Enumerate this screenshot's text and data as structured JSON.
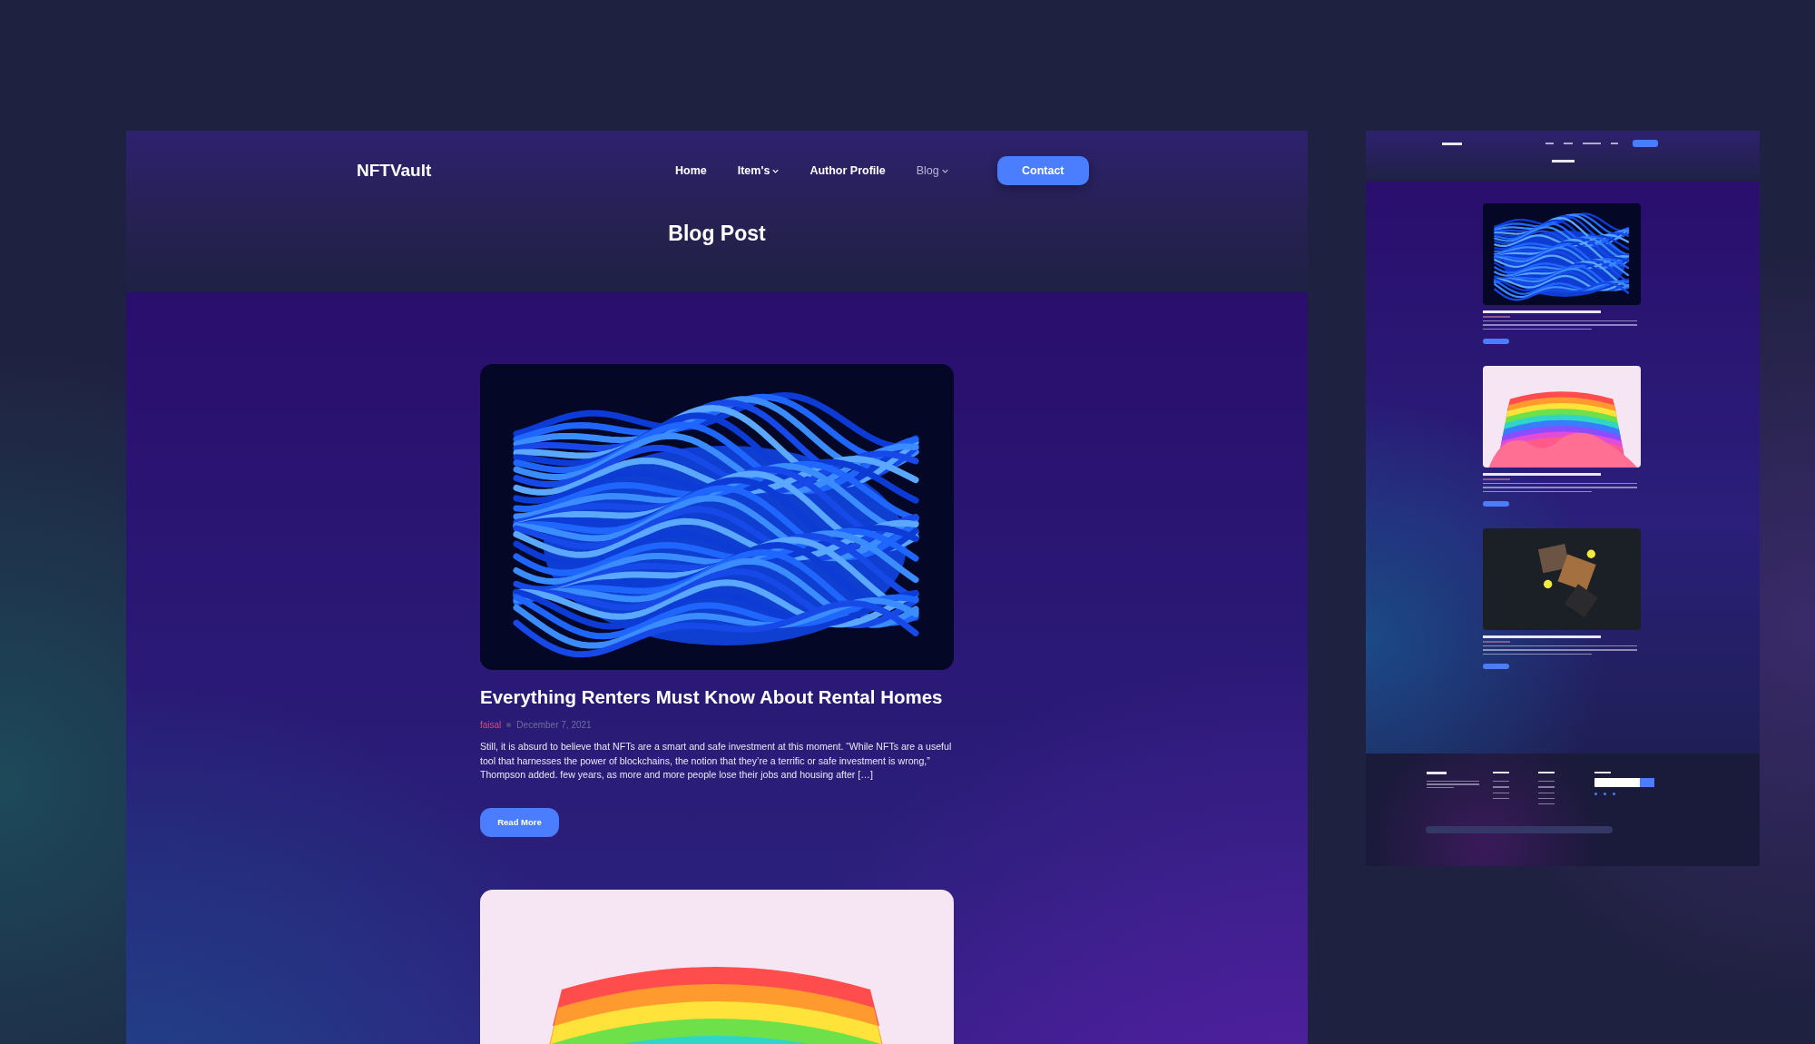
{
  "desktop": {
    "header": {
      "logo": "NFTVault",
      "nav": [
        {
          "label": "Home",
          "dropdown": false,
          "selected": false
        },
        {
          "label": "Item's",
          "dropdown": true,
          "selected": false
        },
        {
          "label": "Author Profile",
          "dropdown": false,
          "selected": false
        },
        {
          "label": "Blog",
          "dropdown": true,
          "selected": true
        }
      ],
      "contact_button": "Contact",
      "page_title": "Blog Post"
    },
    "posts": [
      {
        "kind": "blue-waves",
        "title": "Everything Renters Must Know About Rental Homes",
        "author": "faisal",
        "date": "December 7, 2021",
        "excerpt": "Still, it is absurd to believe that NFTs are a smart and safe investment at this moment. “While NFTs are a useful tool that harnesses the power of blockchains, the notion that they’re a terrific or safe investment is wrong,” Thompson added. few years, as more and more people lose their jobs and housing after […]",
        "button": "Read More"
      },
      {
        "kind": "rainbow-layers"
      }
    ]
  },
  "preview": {
    "posts": [
      {
        "kind": "blue-waves"
      },
      {
        "kind": "rainbow-layers"
      },
      {
        "kind": "glowing-cubes"
      }
    ]
  }
}
